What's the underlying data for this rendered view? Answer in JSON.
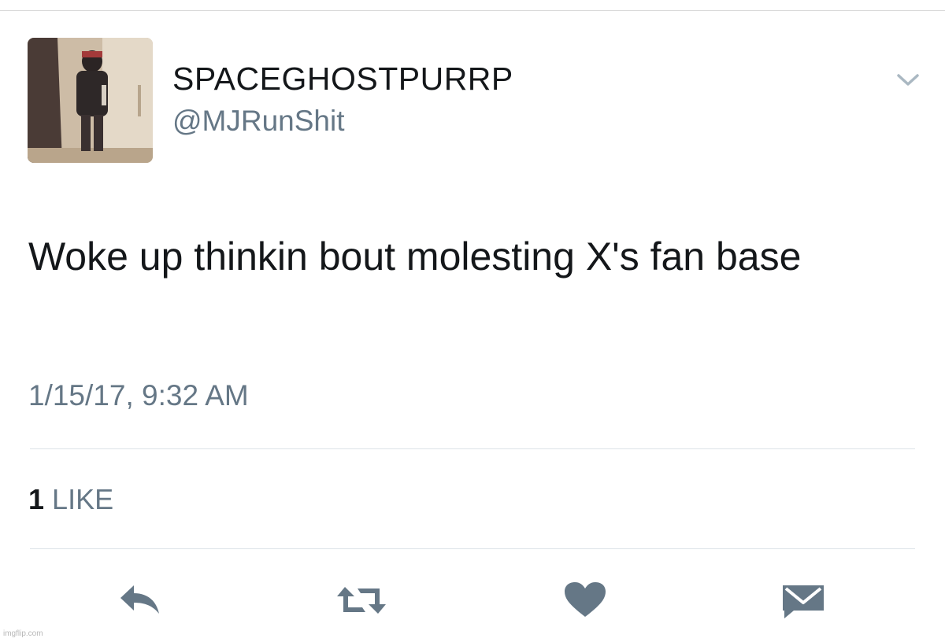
{
  "tweet": {
    "display_name": "SPACEGHOSTPURRP",
    "handle": "@MJRunShit",
    "text": "Woke up thinkin bout molesting X's fan base",
    "timestamp": "1/15/17, 9:32 AM",
    "likes": {
      "count": "1",
      "label": "LIKE"
    }
  },
  "icons": {
    "menu": "chevron-down-icon",
    "reply": "reply-icon",
    "retweet": "retweet-icon",
    "like": "heart-icon",
    "direct_message": "envelope-icon"
  },
  "colors": {
    "text_primary": "#14171a",
    "text_secondary": "#657786",
    "action_icon": "#657786",
    "divider": "#dce3e8"
  },
  "watermark": "imgflip.com"
}
